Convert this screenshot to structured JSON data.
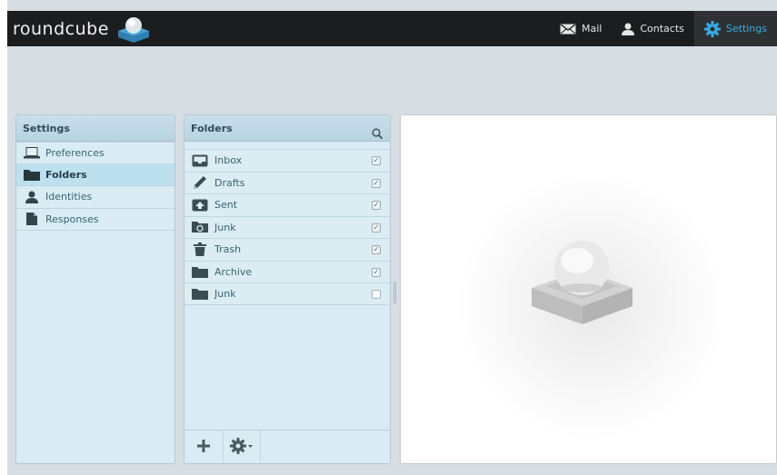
{
  "app": {
    "logo_text": "roundcube"
  },
  "taskbar": [
    {
      "label": "Mail",
      "icon": "envelope-icon",
      "active": false
    },
    {
      "label": "Contacts",
      "icon": "person-icon",
      "active": false
    },
    {
      "label": "Settings",
      "icon": "gear-icon",
      "active": true
    }
  ],
  "settings_panel": {
    "title": "Settings",
    "items": [
      {
        "label": "Preferences",
        "icon": "laptop-icon",
        "selected": false
      },
      {
        "label": "Folders",
        "icon": "folder-icon",
        "selected": true
      },
      {
        "label": "Identities",
        "icon": "person-icon",
        "selected": false
      },
      {
        "label": "Responses",
        "icon": "document-icon",
        "selected": false
      }
    ]
  },
  "folders_panel": {
    "title": "Folders",
    "items": [
      {
        "label": "Inbox",
        "icon": "inbox-icon",
        "subscribed": true
      },
      {
        "label": "Drafts",
        "icon": "pencil-icon",
        "subscribed": true
      },
      {
        "label": "Sent",
        "icon": "sent-icon",
        "subscribed": true
      },
      {
        "label": "Junk",
        "icon": "junk-icon",
        "subscribed": true
      },
      {
        "label": "Trash",
        "icon": "trash-icon",
        "subscribed": true
      },
      {
        "label": "Archive",
        "icon": "folder-icon",
        "subscribed": true
      },
      {
        "label": "Junk",
        "icon": "folder-icon",
        "subscribed": false
      }
    ]
  },
  "colors": {
    "topbar": "#1b1d1e",
    "accent": "#3ba8e0",
    "panel": "#d9ecf4"
  }
}
